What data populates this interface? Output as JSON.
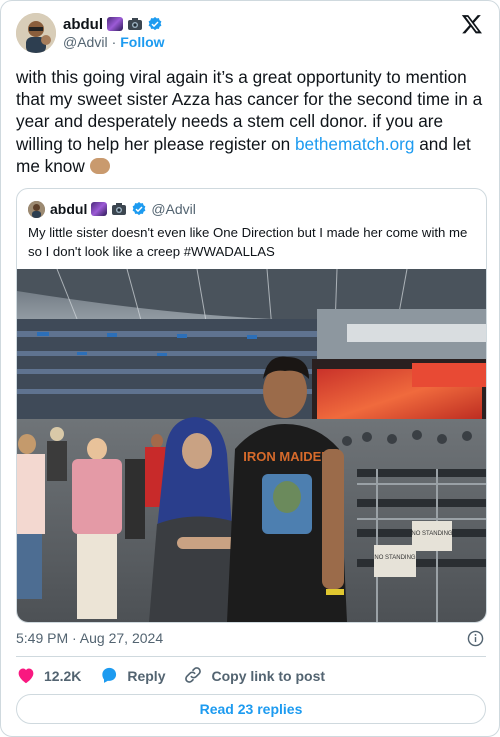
{
  "author": {
    "name": "abdul",
    "handle": "@Advil",
    "separator": "·",
    "follow_label": "Follow"
  },
  "tweet": {
    "text_before_link": "with this going viral again it’s a great opportunity to mention that my sweet sister Azza has cancer for the second time in a year and desperately needs a stem cell donor. if you are willing to help her please register on ",
    "link_text": "bethematch.org",
    "text_after_link": "  and let me know "
  },
  "quoted": {
    "name": "abdul",
    "handle": "@Advil",
    "text": "My little sister doesn't even like One Direction but I made her come with me so I don't look like a creep #WWADALLAS",
    "photo": {
      "shirt_text": "IRON MAIDEN",
      "sign_text_1": "NO STANDING",
      "sign_text_2": "NO STANDING"
    }
  },
  "meta": {
    "timestamp": "5:49 PM · Aug 27, 2024"
  },
  "actions": {
    "like_count": "12.2K",
    "reply_label": "Reply",
    "copy_label": "Copy link to post"
  },
  "read_replies_label": "Read 23 replies",
  "colors": {
    "accent": "#1d9bf0",
    "like_red": "#f91880",
    "text": "#0f1419",
    "muted": "#536471",
    "border": "#cfd9de"
  },
  "icons": [
    "x-logo-icon",
    "verified-icon",
    "heart-icon",
    "reply-icon",
    "link-icon",
    "info-icon",
    "galaxy-emoji-icon",
    "camera-emoji-icon",
    "folded-hands-emoji-icon"
  ]
}
